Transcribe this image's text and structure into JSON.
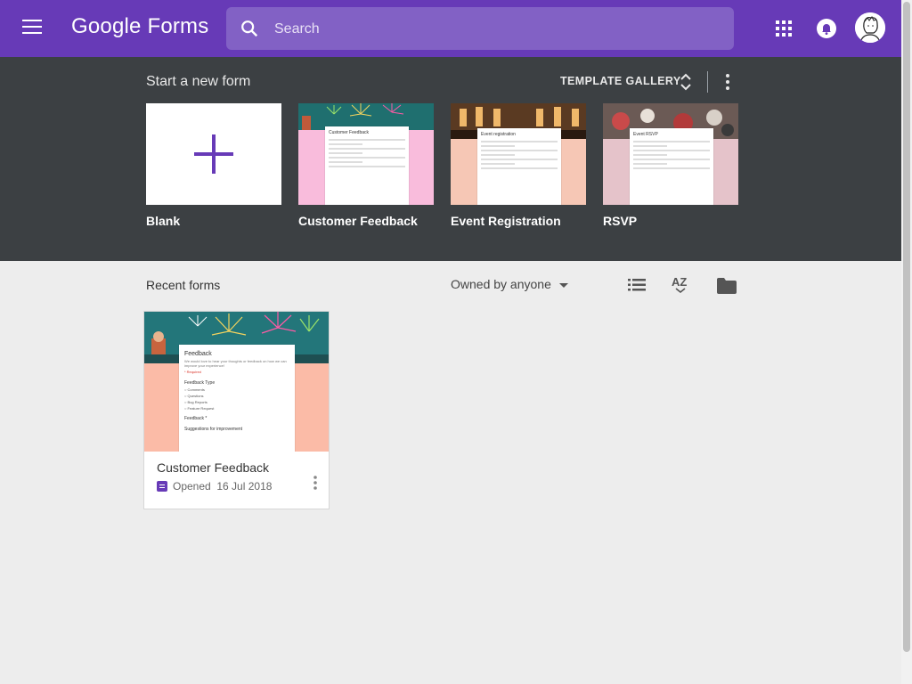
{
  "header": {
    "app_name": "Google Forms",
    "search_placeholder": "Search",
    "brand_color": "#673ab7"
  },
  "templates": {
    "title": "Start a new form",
    "gallery_label": "TEMPLATE GALLERY",
    "items": [
      {
        "label": "Blank"
      },
      {
        "label": "Customer Feedback",
        "preview_title": "Customer Feedback"
      },
      {
        "label": "Event Registration",
        "preview_title": "Event registration"
      },
      {
        "label": "RSVP",
        "preview_title": "Event RSVP"
      }
    ]
  },
  "recent": {
    "title": "Recent forms",
    "owner_filter": "Owned by anyone",
    "sort_label": "AZ",
    "forms": [
      {
        "name": "Customer Feedback",
        "opened_label": "Opened",
        "opened_date": "16 Jul 2018",
        "preview": {
          "title": "Feedback",
          "required": "* Required",
          "section": "Feedback Type",
          "options": [
            "Comments",
            "Questions",
            "Bug Reports",
            "Feature Request"
          ],
          "feedback_label": "Feedback *",
          "suggestions_label": "Suggestions for improvement"
        }
      }
    ]
  }
}
